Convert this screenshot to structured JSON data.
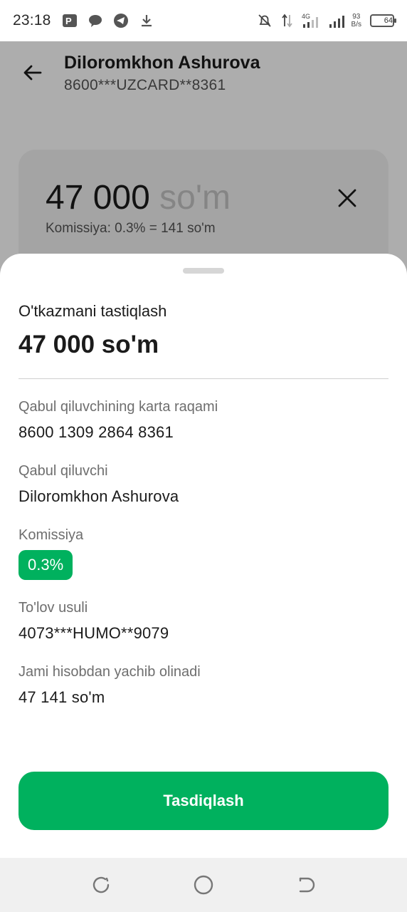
{
  "status_bar": {
    "time": "23:18",
    "network_speed_value": "93",
    "network_speed_unit": "B/s",
    "network_type": "4G",
    "battery": "64",
    "icons": [
      "parking-app-icon",
      "chat-bubble-icon",
      "telegram-icon",
      "download-icon",
      "bell-muted-icon",
      "data-transfer-icon",
      "signal-4g-icon",
      "signal-icon",
      "battery-icon"
    ]
  },
  "header": {
    "recipient_name": "Diloromkhon Ashurova",
    "recipient_card": "8600***UZCARD**8361"
  },
  "amount_card": {
    "amount": "47 000",
    "unit": "so'm",
    "commission_line": "Komissiya: 0.3% = 141 so'm"
  },
  "sheet": {
    "title": "O'tkazmani tastiqlash",
    "amount": "47 000 so'm",
    "fields": {
      "card_label": "Qabul qiluvchining karta raqami",
      "card_value": "8600 1309 2864 8361",
      "recipient_label": "Qabul qiluvchi",
      "recipient_value": "Diloromkhon Ashurova",
      "commission_label": "Komissiya",
      "commission_value": "0.3%",
      "payment_method_label": "To'lov usuli",
      "payment_method_value": "4073***HUMO**9079",
      "total_label": "Jami hisobdan yachib olinadi",
      "total_value": "47 141 so'm"
    },
    "confirm_label": "Tasdiqlash"
  },
  "colors": {
    "accent": "#00b15e",
    "scrim": "rgba(0,0,0,0.32)"
  }
}
